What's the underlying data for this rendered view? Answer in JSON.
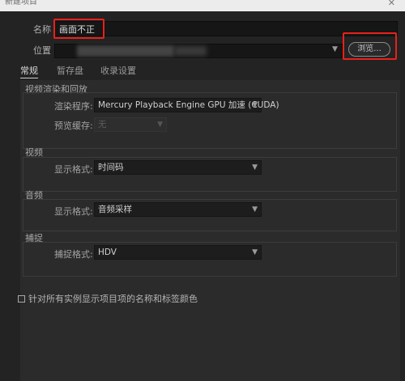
{
  "window": {
    "title": "新建项目",
    "close_glyph": "✕"
  },
  "name_field": {
    "label": "名称",
    "value": "画面不正"
  },
  "location_field": {
    "label": "位置",
    "browse_label": "浏览..."
  },
  "tabs": [
    {
      "label": "常规",
      "active": true
    },
    {
      "label": "暂存盘",
      "active": false
    },
    {
      "label": "收录设置",
      "active": false
    }
  ],
  "video_render": {
    "title": "视频渲染和回放",
    "renderer_label": "渲染程序:",
    "renderer_value": "Mercury Playback Engine GPU 加速 (CUDA)",
    "preview_cache_label": "预览缓存:",
    "preview_cache_value": "无"
  },
  "video": {
    "title": "视频",
    "display_format_label": "显示格式:",
    "display_format_value": "时间码"
  },
  "audio": {
    "title": "音频",
    "display_format_label": "显示格式:",
    "display_format_value": "音频采样"
  },
  "capture": {
    "title": "捕捉",
    "capture_format_label": "捕捉格式:",
    "capture_format_value": "HDV"
  },
  "checkbox": {
    "label": "针对所有实例显示项目项的名称和标签颜色",
    "checked": false
  },
  "colors": {
    "annotation_red": "#e8211a",
    "dialog_bg": "#232323",
    "panel_bg": "#2b2b2b"
  },
  "icons": {
    "dropdown": "chevron-down-icon",
    "close": "close-icon"
  }
}
